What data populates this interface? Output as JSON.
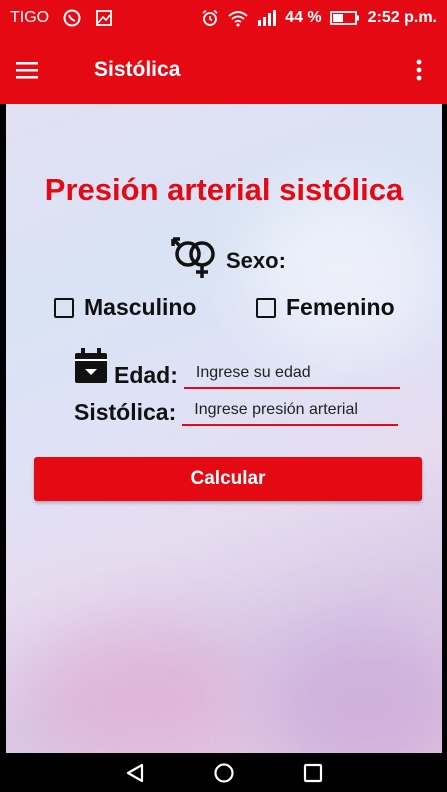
{
  "status_bar": {
    "carrier": "TIGO",
    "battery_percent": "44 %",
    "time": "2:52 p.m.",
    "icons": [
      "whatsapp-icon",
      "gallery-icon",
      "alarm-icon",
      "wifi-icon",
      "signal-icon",
      "battery-icon"
    ]
  },
  "app_bar": {
    "title": "Sistólica",
    "menu_icon": "hamburger-menu-icon",
    "overflow_icon": "more-vert-icon"
  },
  "form": {
    "heading": "Presión arterial sistólica",
    "sexo_label": "Sexo:",
    "sexo_icon": "gender-symbol-icon",
    "options": {
      "masculino": "Masculino",
      "femenino": "Femenino"
    },
    "edad_label": "Edad:",
    "edad_icon": "calendar-icon",
    "edad_placeholder": "Ingrese su edad",
    "sistolica_label": "Sistólica:",
    "sistolica_placeholder": "Ingrese presión arterial",
    "submit_label": "Calcular"
  },
  "nav": {
    "back": "back-triangle-icon",
    "home": "home-circle-icon",
    "recents": "recents-square-icon"
  },
  "colors": {
    "accent": "#e50914",
    "text": "#111111"
  }
}
